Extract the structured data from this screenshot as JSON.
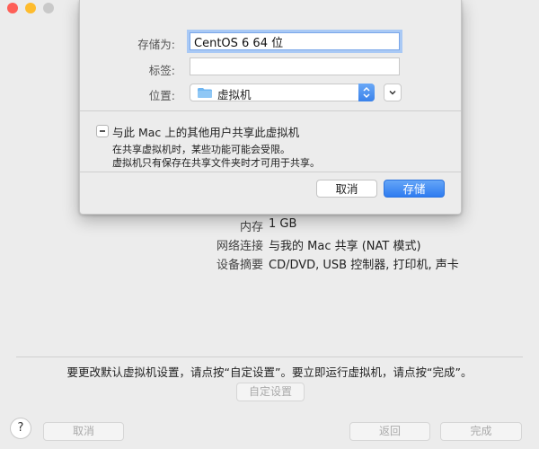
{
  "summary": {
    "rows": [
      {
        "label": "内存",
        "value": "1 GB"
      },
      {
        "label": "网络连接",
        "value": "与我的 Mac 共享 (NAT 模式)"
      },
      {
        "label": "设备摘要",
        "value": "CD/DVD, USB 控制器, 打印机, 声卡"
      }
    ]
  },
  "hint": "要更改默认虚拟机设置，请点按“自定设置”。要立即运行虚拟机，请点按“完成”。",
  "custom_button": "自定设置",
  "footer": {
    "help": "?",
    "cancel": "取消",
    "back": "返回",
    "finish": "完成"
  },
  "sheet": {
    "save_as_label": "存储为:",
    "save_as_value": "CentOS 6 64 位",
    "tags_label": "标签:",
    "tags_value": "",
    "location_label": "位置:",
    "location_value": "虚拟机",
    "share_label": "与此 Mac 上的其他用户共享此虚拟机",
    "share_desc_1": "在共享虚拟机时，某些功能可能会受限。",
    "share_desc_2": "虚拟机只有保存在共享文件夹时才可用于共享。",
    "cancel": "取消",
    "save": "存储"
  },
  "colors": {
    "accent": "#3a82ea",
    "focus_ring": "#a9c9f5"
  }
}
